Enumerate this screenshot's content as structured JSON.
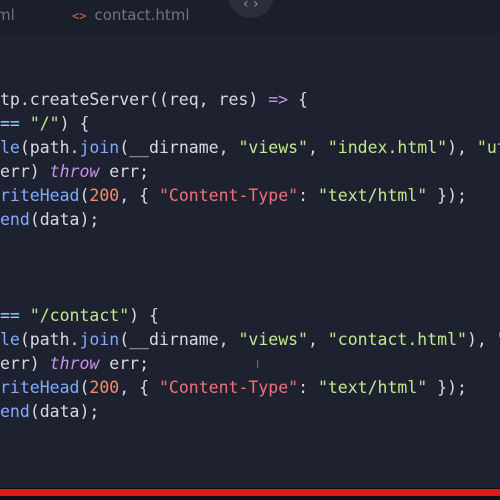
{
  "tabs": [
    {
      "label": "ml",
      "icon": "html-file-icon"
    },
    {
      "label": "contact.html",
      "icon": "code-brackets-icon",
      "icon_glyph": "<>"
    }
  ],
  "code_lines": [
    [
      {
        "t": "tp.createServer((req, res) ",
        "c": "plain"
      },
      {
        "t": "=>",
        "c": "kw"
      },
      {
        "t": " {",
        "c": "plain"
      }
    ],
    [
      {
        "t": "== ",
        "c": "pun"
      },
      {
        "t": "\"/\"",
        "c": "str"
      },
      {
        "t": ") {",
        "c": "plain"
      }
    ],
    [
      {
        "t": "le",
        "c": "fn"
      },
      {
        "t": "(path.",
        "c": "plain"
      },
      {
        "t": "join",
        "c": "fn"
      },
      {
        "t": "(__dirname, ",
        "c": "plain"
      },
      {
        "t": "\"views\"",
        "c": "str"
      },
      {
        "t": ", ",
        "c": "plain"
      },
      {
        "t": "\"index.html\"",
        "c": "str"
      },
      {
        "t": "), ",
        "c": "plain"
      },
      {
        "t": "\"utf",
        "c": "str"
      }
    ],
    [
      {
        "t": "err) ",
        "c": "plain"
      },
      {
        "t": "throw",
        "c": "kw"
      },
      {
        "t": " err;",
        "c": "plain"
      }
    ],
    [
      {
        "t": "riteHead",
        "c": "fn"
      },
      {
        "t": "(",
        "c": "plain"
      },
      {
        "t": "200",
        "c": "num"
      },
      {
        "t": ", { ",
        "c": "plain"
      },
      {
        "t": "\"Content-Type\"",
        "c": "var"
      },
      {
        "t": ": ",
        "c": "plain"
      },
      {
        "t": "\"text/html\"",
        "c": "str"
      },
      {
        "t": " });",
        "c": "plain"
      }
    ],
    [
      {
        "t": "end",
        "c": "fn"
      },
      {
        "t": "(data);",
        "c": "plain"
      }
    ],
    [],
    [],
    [],
    [
      {
        "t": "== ",
        "c": "pun"
      },
      {
        "t": "\"/contact\"",
        "c": "str"
      },
      {
        "t": ") {",
        "c": "plain"
      }
    ],
    [
      {
        "t": "le",
        "c": "fn"
      },
      {
        "t": "(path.",
        "c": "plain"
      },
      {
        "t": "join",
        "c": "fn"
      },
      {
        "t": "(__dirname, ",
        "c": "plain"
      },
      {
        "t": "\"views\"",
        "c": "str"
      },
      {
        "t": ", ",
        "c": "plain"
      },
      {
        "t": "\"contact.html\"",
        "c": "str"
      },
      {
        "t": "), ",
        "c": "plain"
      },
      {
        "t": "\"u",
        "c": "str"
      }
    ],
    [
      {
        "t": "err) ",
        "c": "plain"
      },
      {
        "t": "throw",
        "c": "kw"
      },
      {
        "t": " err;",
        "c": "plain"
      }
    ],
    [
      {
        "t": "riteHead",
        "c": "fn"
      },
      {
        "t": "(",
        "c": "plain"
      },
      {
        "t": "200",
        "c": "num"
      },
      {
        "t": ", { ",
        "c": "plain"
      },
      {
        "t": "\"Content-Type\"",
        "c": "var"
      },
      {
        "t": ": ",
        "c": "plain"
      },
      {
        "t": "\"text/html\"",
        "c": "str"
      },
      {
        "t": " });",
        "c": "plain"
      }
    ],
    [
      {
        "t": "end",
        "c": "fn"
      },
      {
        "t": "(data);",
        "c": "plain"
      }
    ]
  ],
  "video": {
    "progress_fraction": 1.0,
    "progress_color": "#e31818"
  },
  "colors": {
    "background": "#1e2130",
    "keyword": "#c792ea",
    "string": "#c3e88d",
    "number": "#f78c6c",
    "function": "#82aaff"
  }
}
